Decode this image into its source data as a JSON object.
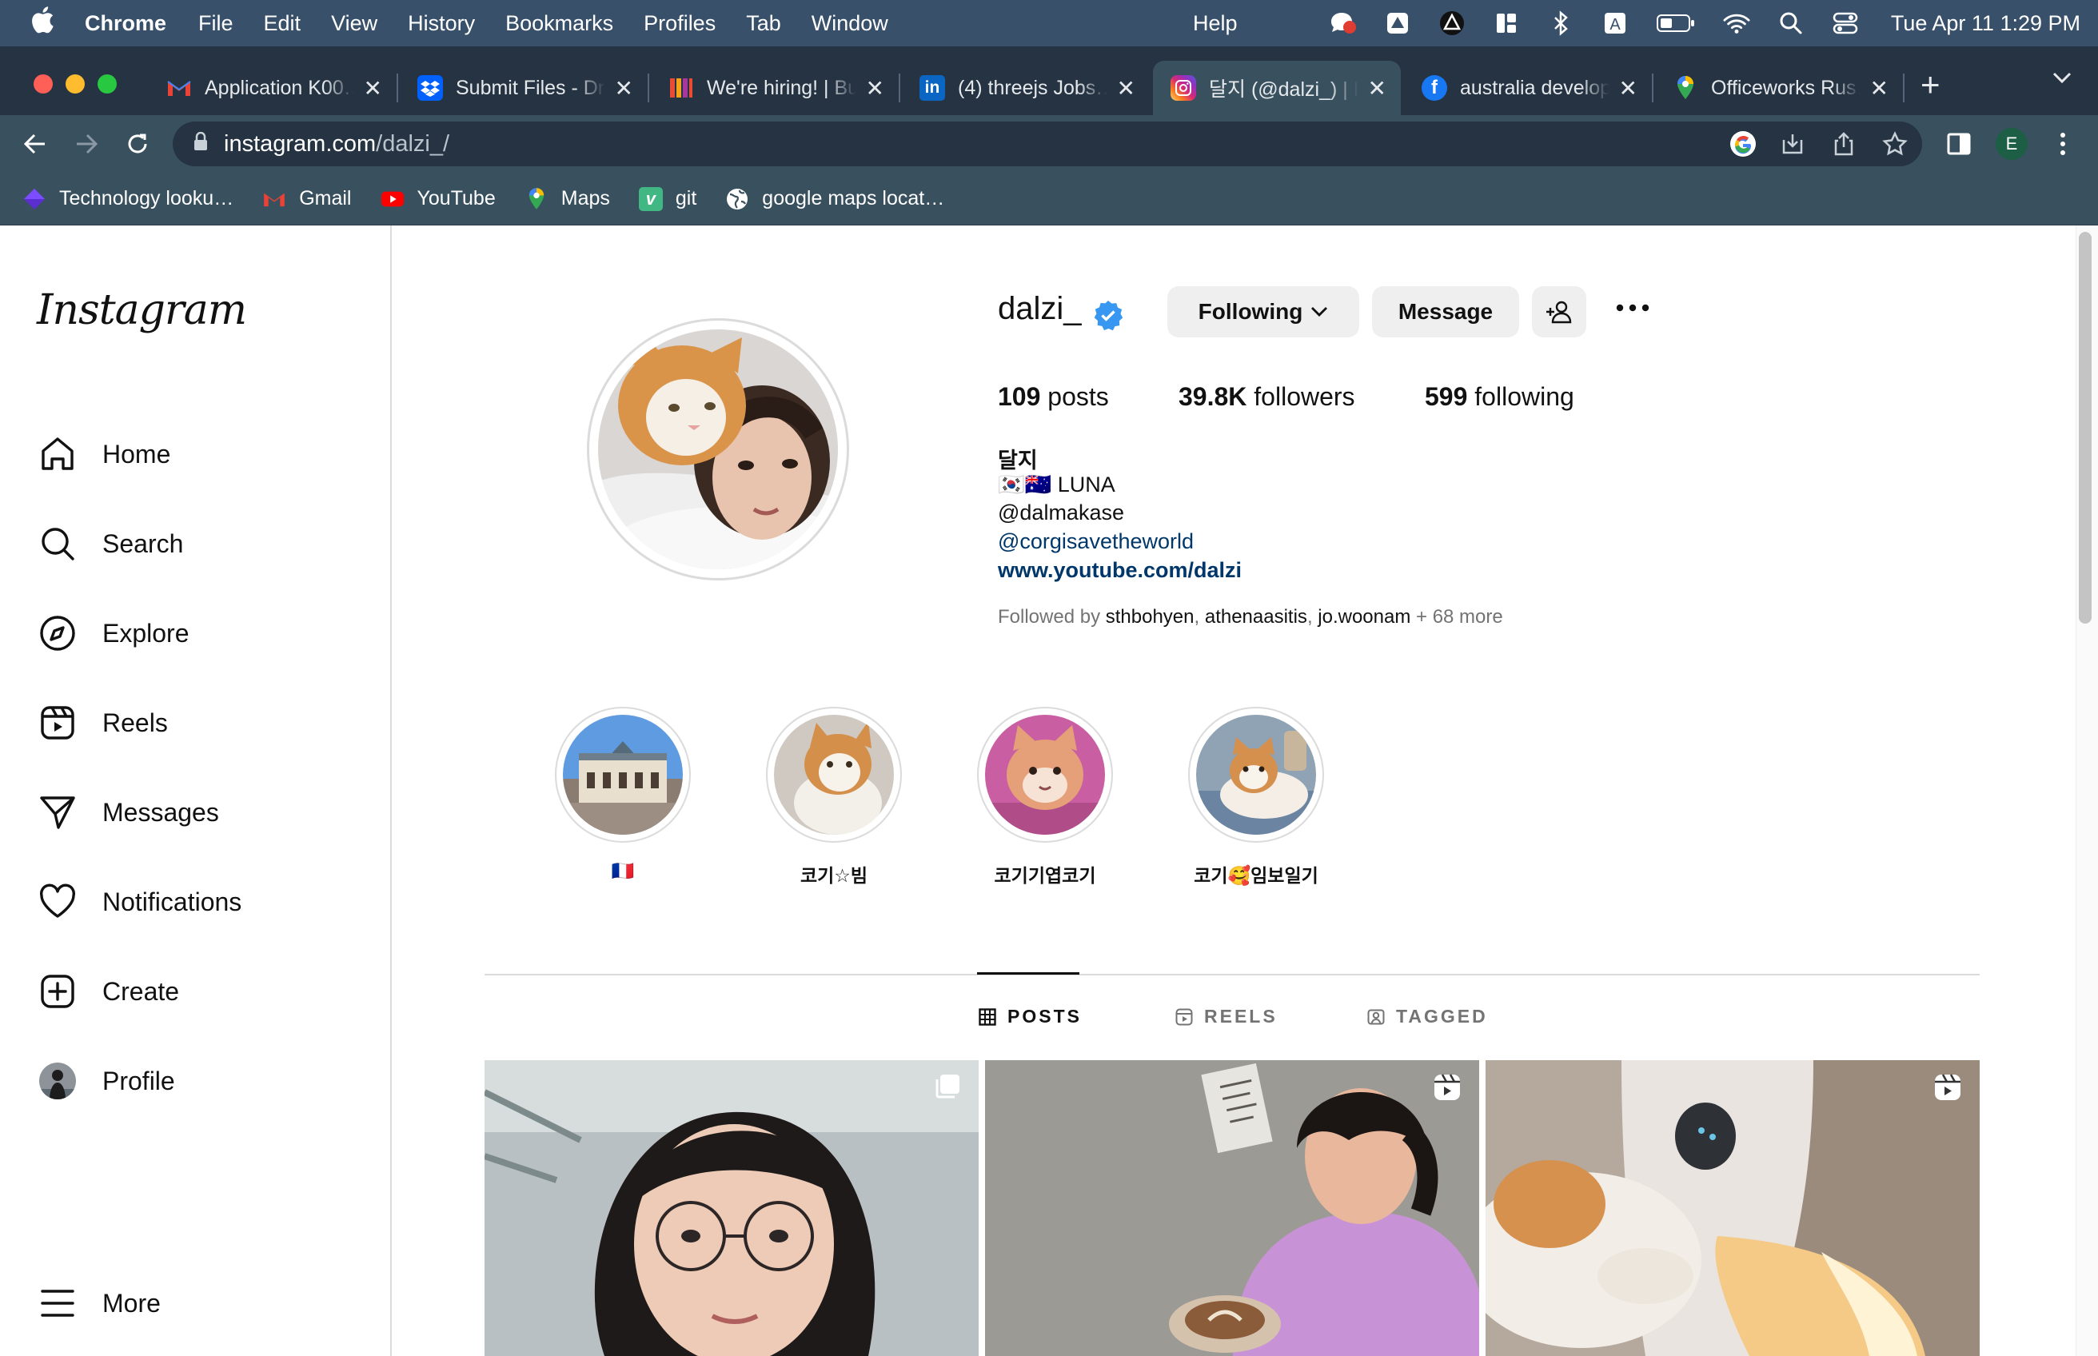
{
  "menubar": {
    "app": "Chrome",
    "items": [
      "File",
      "Edit",
      "View",
      "History",
      "Bookmarks",
      "Profiles",
      "Tab",
      "Window"
    ],
    "help": "Help",
    "clock": "Tue Apr 11  1:29 PM"
  },
  "tabs": [
    {
      "title": "Application K00…",
      "icon": "gmail-icon",
      "color": "#ea4335"
    },
    {
      "title": "Submit Files - Dr…",
      "icon": "dropbox-icon",
      "color": "#0061fe"
    },
    {
      "title": "We're hiring! | Bu…",
      "icon": "bamboohr-icon",
      "color": "#e94b35"
    },
    {
      "title": "(4) threejs Jobs…",
      "icon": "linkedin-icon",
      "color": "#0a66c2"
    },
    {
      "title": "달지 (@dalzi_) | Ins…",
      "icon": "instagram-icon",
      "color": "#d6249f"
    },
    {
      "title": "australia develop…",
      "icon": "facebook-icon",
      "color": "#1877f2"
    },
    {
      "title": "Officeworks Rus…",
      "icon": "maps-pin-icon",
      "color": "#34a853"
    }
  ],
  "omnibox": {
    "host": "instagram.com",
    "path": "/dalzi_/"
  },
  "profile_initial": "E",
  "bookmarks": [
    {
      "label": "Technology looku…",
      "icon": "diamond-icon"
    },
    {
      "label": "Gmail",
      "icon": "gmail-icon"
    },
    {
      "label": "YouTube",
      "icon": "youtube-icon"
    },
    {
      "label": "Maps",
      "icon": "maps-pin-icon"
    },
    {
      "label": "git",
      "icon": "vue-icon"
    },
    {
      "label": "google maps locat…",
      "icon": "globe-icon"
    }
  ],
  "instagram": {
    "logo": "Instagram",
    "nav": [
      {
        "label": "Home",
        "icon": "home-icon"
      },
      {
        "label": "Search",
        "icon": "search-icon"
      },
      {
        "label": "Explore",
        "icon": "compass-icon"
      },
      {
        "label": "Reels",
        "icon": "reels-icon"
      },
      {
        "label": "Messages",
        "icon": "send-icon"
      },
      {
        "label": "Notifications",
        "icon": "heart-icon"
      },
      {
        "label": "Create",
        "icon": "plus-square-icon"
      },
      {
        "label": "Profile",
        "icon": "avatar-icon"
      }
    ],
    "more": "More",
    "profile": {
      "username": "dalzi_",
      "following_button": "Following",
      "message_button": "Message",
      "stats": {
        "posts_count": "109",
        "posts_label": "posts",
        "followers_count": "39.8K",
        "followers_label": "followers",
        "following_count": "599",
        "following_label": "following"
      },
      "bio": {
        "name": "달지",
        "line2": "🇰🇷🇦🇺 LUNA",
        "line3": "@dalmakase",
        "mention": "@corgisavetheworld",
        "website": "www.youtube.com/dalzi"
      },
      "followed_by": {
        "prefix": "Followed by ",
        "user1": "sthbohyen",
        "user2": "athenaasitis",
        "user3": "jo.woonam",
        "suffix": " + 68 more"
      }
    },
    "highlights": [
      {
        "label": "🇫🇷"
      },
      {
        "label": "코기☆빔"
      },
      {
        "label": "코기기엽코기"
      },
      {
        "label": "코기🥰임보일기"
      }
    ],
    "tabs": {
      "posts": "POSTS",
      "reels": "REELS",
      "tagged": "TAGGED"
    },
    "accent": "#0095f6"
  }
}
